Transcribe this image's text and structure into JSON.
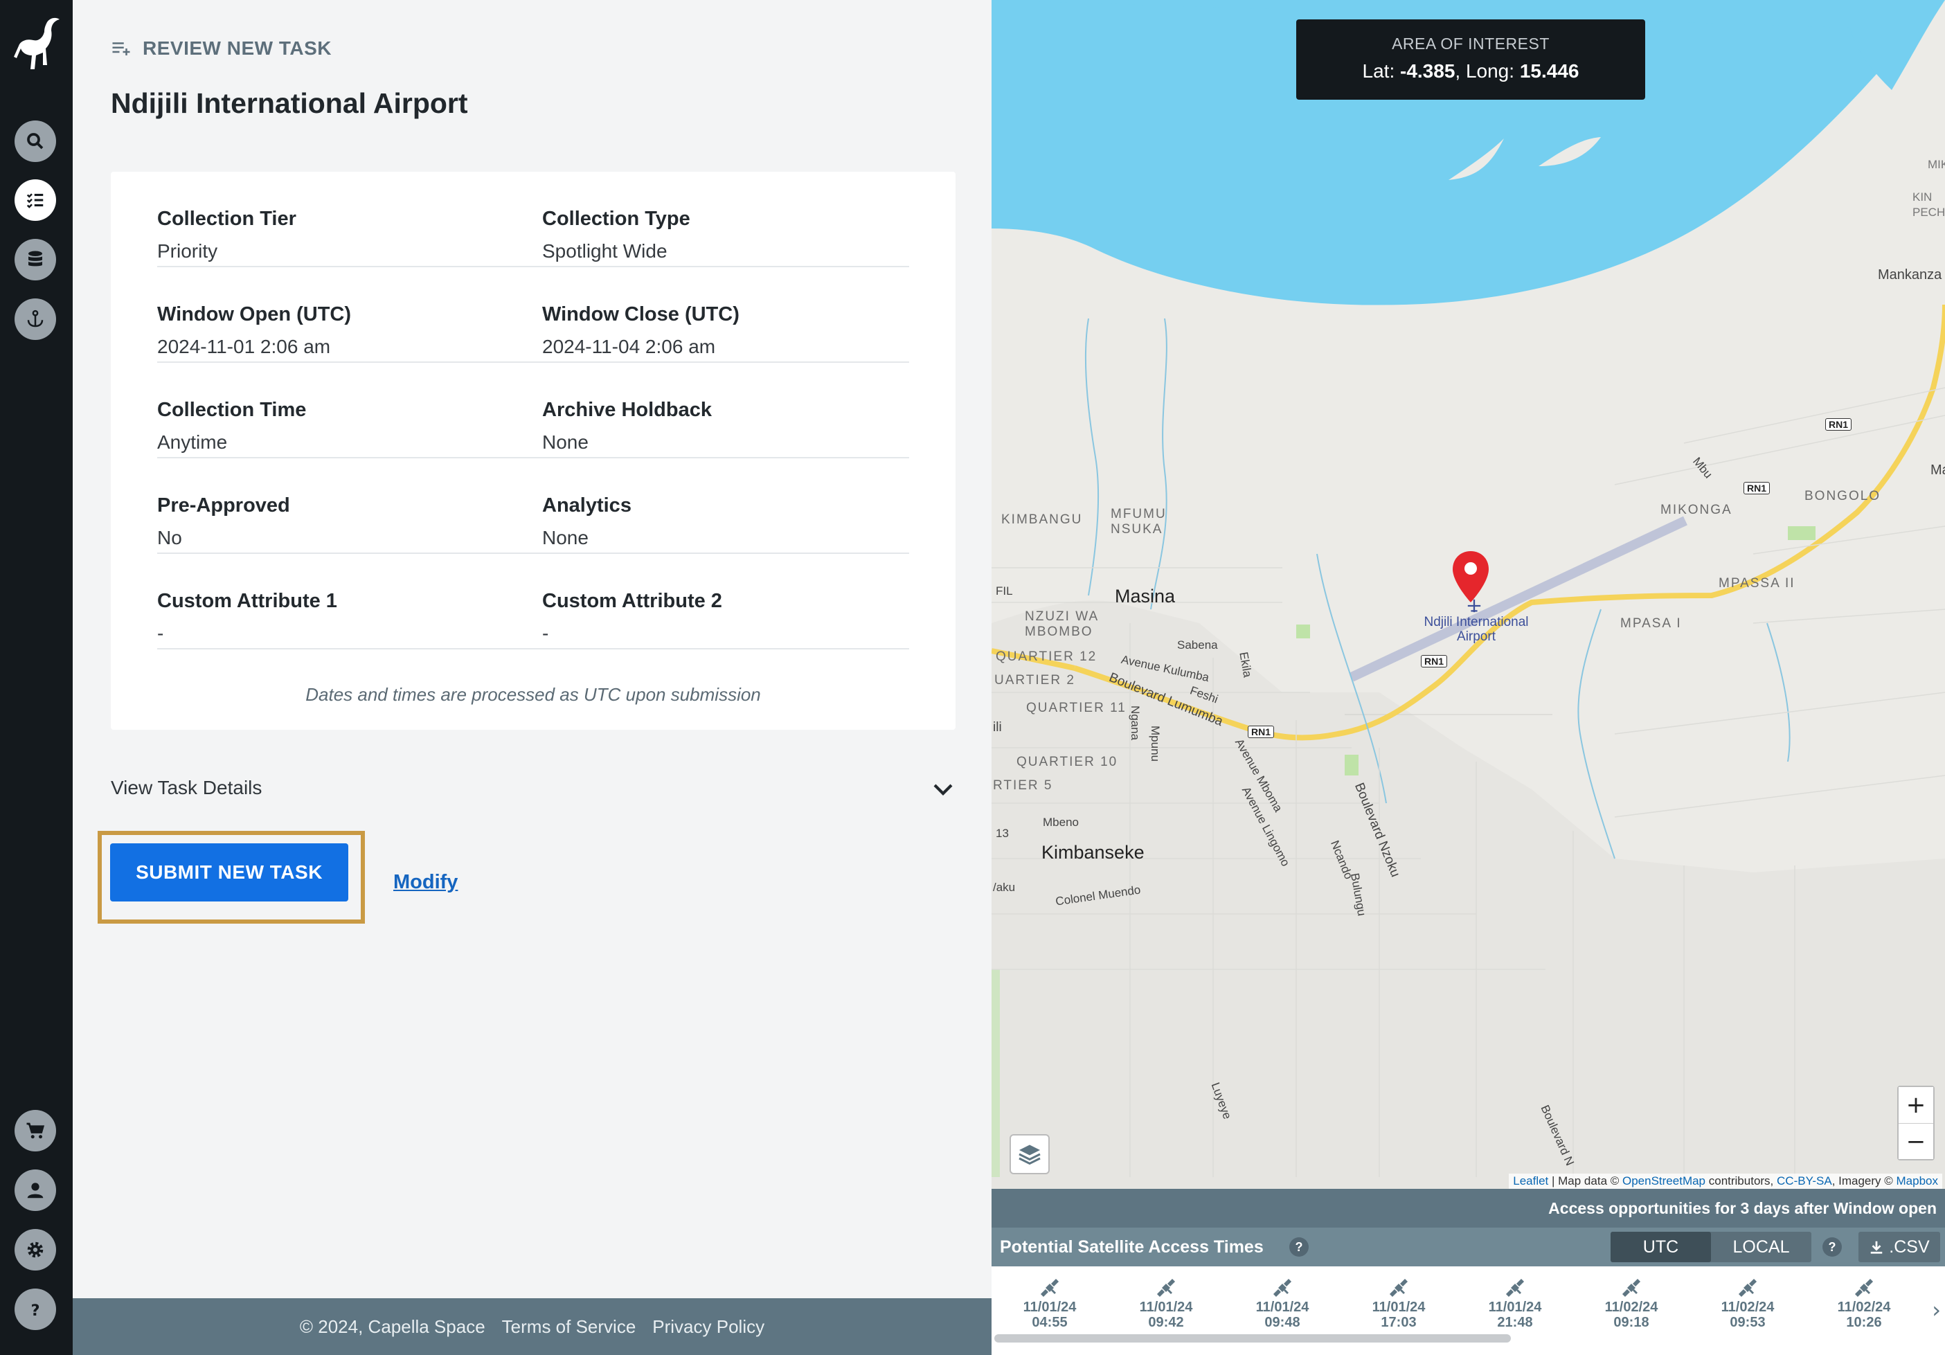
{
  "sidebar": {
    "nav": [
      "search-icon",
      "tasks-icon",
      "database-icon",
      "anchor-icon"
    ],
    "bottom": [
      "cart-icon",
      "user-icon",
      "gear-icon",
      "help-icon"
    ]
  },
  "header": {
    "section": "REVIEW NEW TASK",
    "title": "Ndijili International Airport"
  },
  "details": {
    "rows": [
      {
        "l1": "Collection Tier",
        "v1": "Priority",
        "l2": "Collection Type",
        "v2": "Spotlight Wide"
      },
      {
        "l1": "Window Open (UTC)",
        "v1": "2024-11-01 2:06 am",
        "l2": "Window Close (UTC)",
        "v2": "2024-11-04 2:06 am"
      },
      {
        "l1": "Collection Time",
        "v1": "Anytime",
        "l2": "Archive Holdback",
        "v2": "None"
      },
      {
        "l1": "Pre-Approved",
        "v1": "No",
        "l2": "Analytics",
        "v2": "None"
      },
      {
        "l1": "Custom Attribute 1",
        "v1": "-",
        "l2": "Custom Attribute 2",
        "v2": "-"
      }
    ],
    "note": "Dates and times are processed as UTC upon submission"
  },
  "view_details": "View Task Details",
  "actions": {
    "submit": "SUBMIT NEW TASK",
    "modify": "Modify"
  },
  "footer": {
    "copyright": "© 2024, Capella Space",
    "terms": "Terms of Service",
    "privacy": "Privacy Policy"
  },
  "map": {
    "aoi_title": "AREA OF INTEREST",
    "lat_label": "Lat:",
    "lat": "-4.385",
    "long_label": "Long:",
    "long": "15.446",
    "airport": "Ndjili International Airport",
    "labels": {
      "mankanza": "Mankanza",
      "ma": "Ma",
      "mik": "MIK",
      "kinpech": "KIN\nPECH",
      "bongolo": "BONGOLO",
      "mikonga": "MIKONGA",
      "mpassa2": "MPASSA II",
      "mpassa1": "MPASA I",
      "kimbangu": "KIMBANGU",
      "mfumu": "MFUMU\nNSUKA",
      "masina": "Masina",
      "nzuzi": "NZUZI WA\nMBOMBO",
      "q12": "QUARTIER 12",
      "q2": "UARTIER 2",
      "q11": "QUARTIER 11",
      "q10": "QUARTIER 10",
      "q5": "RTIER 5",
      "kimbanseke": "Kimbanseke",
      "mbeno": "Mbeno",
      "sabena": "Sabena",
      "kulumba": "Avenue Kulumba",
      "lumumba": "Boulevard Lumumba",
      "feshi": "Feshi",
      "ekila": "Ekila",
      "colonel": "Colonel Muendo",
      "nzoku": "Boulevard Nzoku",
      "ncando": "Ncando",
      "bulungu": "Bulungu",
      "mboma": "Avenue Mboma",
      "lingomo": "Avenue Lingomo",
      "ngana": "Ngana",
      "mpunu": "Mpunu",
      "luyeye": "Luyeye",
      "blvdn": "Boulevard N",
      "fil": "FIL",
      "ili": "ili",
      "n13": "13",
      "vaku": "/aku",
      "mbu": "Mbu",
      "rn1": "RN1"
    },
    "attribution": {
      "leaflet": "Leaflet",
      "data": " | Map data © ",
      "osm": "OpenStreetMap",
      "contrib": " contributors, ",
      "cc": "CC-BY-SA",
      "imagery": ", Imagery © ",
      "mapbox": "Mapbox"
    },
    "zoom_in": "+",
    "zoom_out": "−"
  },
  "satellite": {
    "banner": "Access opportunities for 3 days after Window open",
    "title": "Potential Satellite Access Times",
    "help": "?",
    "tz": [
      "UTC",
      "LOCAL"
    ],
    "csv": ".CSV",
    "times": [
      {
        "date": "11/01/24",
        "time": "04:55"
      },
      {
        "date": "11/01/24",
        "time": "09:42"
      },
      {
        "date": "11/01/24",
        "time": "09:48"
      },
      {
        "date": "11/01/24",
        "time": "17:03"
      },
      {
        "date": "11/01/24",
        "time": "21:48"
      },
      {
        "date": "11/02/24",
        "time": "09:18"
      },
      {
        "date": "11/02/24",
        "time": "09:53"
      },
      {
        "date": "11/02/24",
        "time": "10:26"
      }
    ]
  }
}
